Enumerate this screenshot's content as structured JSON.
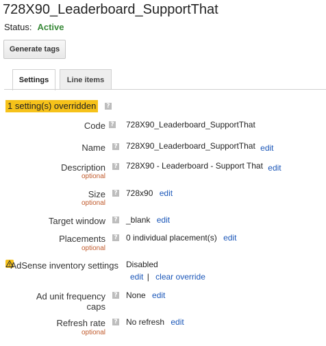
{
  "title": "728X90_Leaderboard_SupportThat",
  "status": {
    "label": "Status:",
    "value": "Active",
    "color": "#3a8a3a"
  },
  "generate_tags_label": "Generate tags",
  "tabs": [
    {
      "label": "Settings",
      "active": true
    },
    {
      "label": "Line items",
      "active": false
    }
  ],
  "override_notice": "1 setting(s) overridden",
  "help_glyph": "?",
  "optional_text": "optional",
  "fields": {
    "code": {
      "label": "Code",
      "value": "728X90_Leaderboard_SupportThat"
    },
    "name": {
      "label": "Name",
      "value": "728X90_Leaderboard_SupportThat",
      "action": "edit"
    },
    "description": {
      "label": "Description",
      "value": "728X90 - Leaderboard - Support That",
      "action": "edit"
    },
    "size": {
      "label": "Size",
      "value": "728x90",
      "action": "edit"
    },
    "target_window": {
      "label": "Target window",
      "value": "_blank",
      "action": "edit"
    },
    "placements": {
      "label": "Placements",
      "value": "0 individual placement(s)",
      "action": "edit"
    },
    "adsense": {
      "label": "AdSense inventory settings",
      "value": "Disabled",
      "action": "edit",
      "separator": "|",
      "action2": "clear override"
    },
    "frequency_caps": {
      "label_line1": "Ad unit frequency",
      "label_line2": "caps",
      "value": "None",
      "action": "edit"
    },
    "refresh_rate": {
      "label": "Refresh rate",
      "value": "No refresh",
      "action": "edit"
    }
  },
  "colors": {
    "badge": "#f6c21a",
    "link": "#1a56b8",
    "optional": "#c0592a"
  }
}
